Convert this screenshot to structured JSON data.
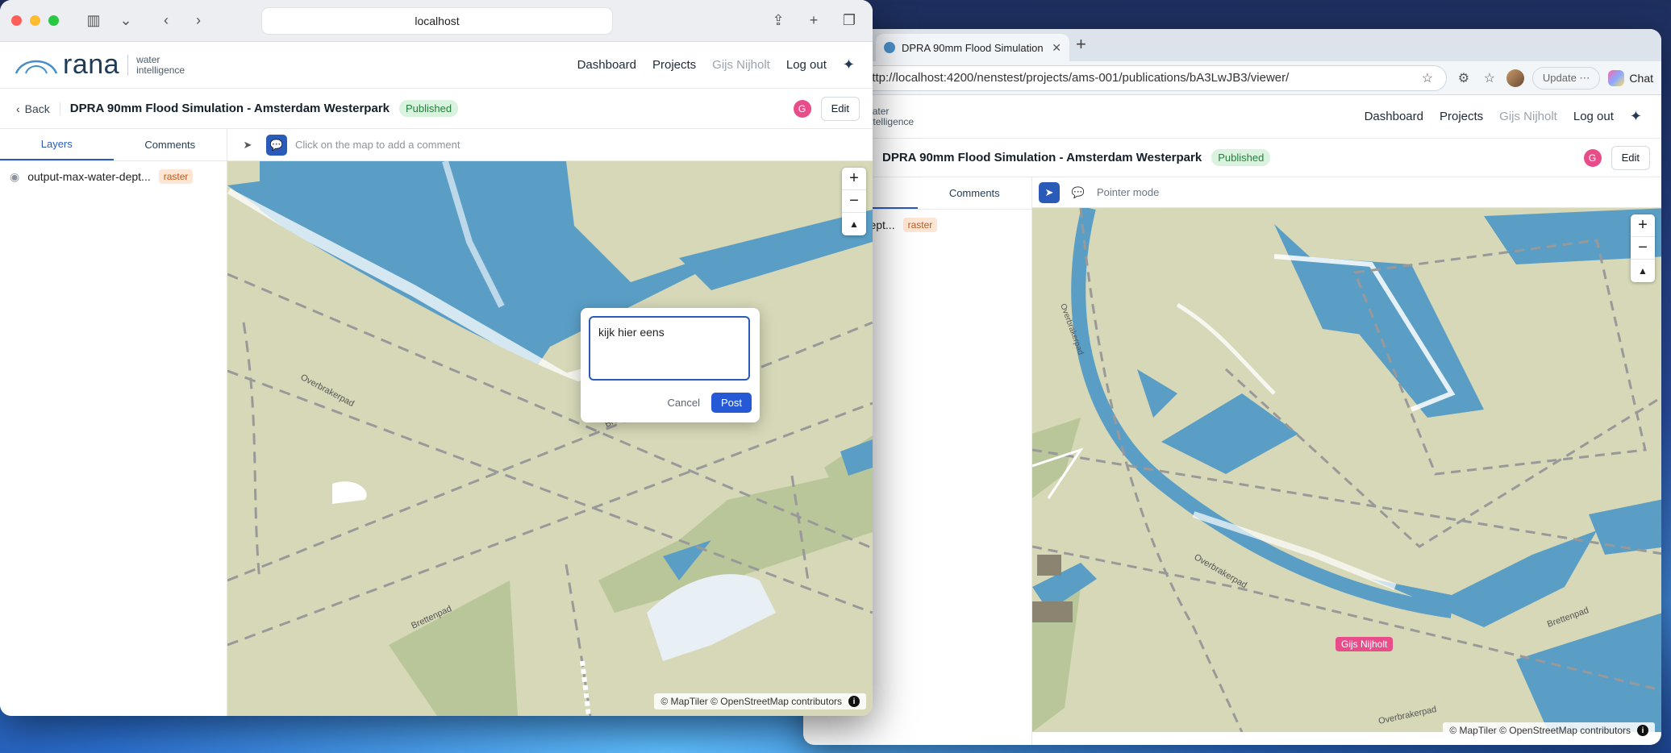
{
  "safari": {
    "url": "localhost"
  },
  "chrome": {
    "tab_title": "DPRA 90mm Flood Simulation -",
    "url": "http://localhost:4200/nenstest/projects/ams-001/publications/bA3LwJB3/viewer/",
    "update": "Update",
    "update_more": "⋯",
    "chat": "Chat"
  },
  "app": {
    "logo": "rana",
    "logo_sub1": "water",
    "logo_sub2": "intelligence",
    "nav": {
      "dashboard": "Dashboard",
      "projects": "Projects",
      "user": "Gijs Nijholt",
      "logout": "Log out"
    },
    "back": "Back",
    "title": "DPRA 90mm Flood Simulation - Amsterdam Westerpark",
    "status": "Published",
    "avatar": "G",
    "edit": "Edit",
    "tabs": {
      "layers": "Layers",
      "comments": "Comments"
    },
    "back_tabs": {
      "layers_partial": "s"
    },
    "layer": {
      "name": "output-max-water-dept...",
      "back_name": "-max-water-dept...",
      "tag": "raster"
    },
    "front_hint": "Click on the map to add a comment",
    "back_hint": "Pointer mode",
    "attribution": "© MapTiler © OpenStreetMap contributors",
    "comment": {
      "text": "kijk hier eens",
      "cancel": "Cancel",
      "post": "Post"
    },
    "cursor_user": "Gijs Nijholt",
    "streets": {
      "a": "Overbrakerpad",
      "b": "Brettenpad",
      "c": "Brettenpad",
      "d": "Overbrakerpad",
      "e": "Overbrakerpad",
      "f": "Brettenpad",
      "g": "Brettenpad",
      "h": "Overbrakerpad"
    }
  },
  "colors": {
    "water": "#5a9ec6",
    "land": "#d6d8b8",
    "green": "#b9c69a",
    "accent": "#2a5bb8",
    "published_bg": "#daf3df",
    "raster_bg": "#fde6d4"
  }
}
